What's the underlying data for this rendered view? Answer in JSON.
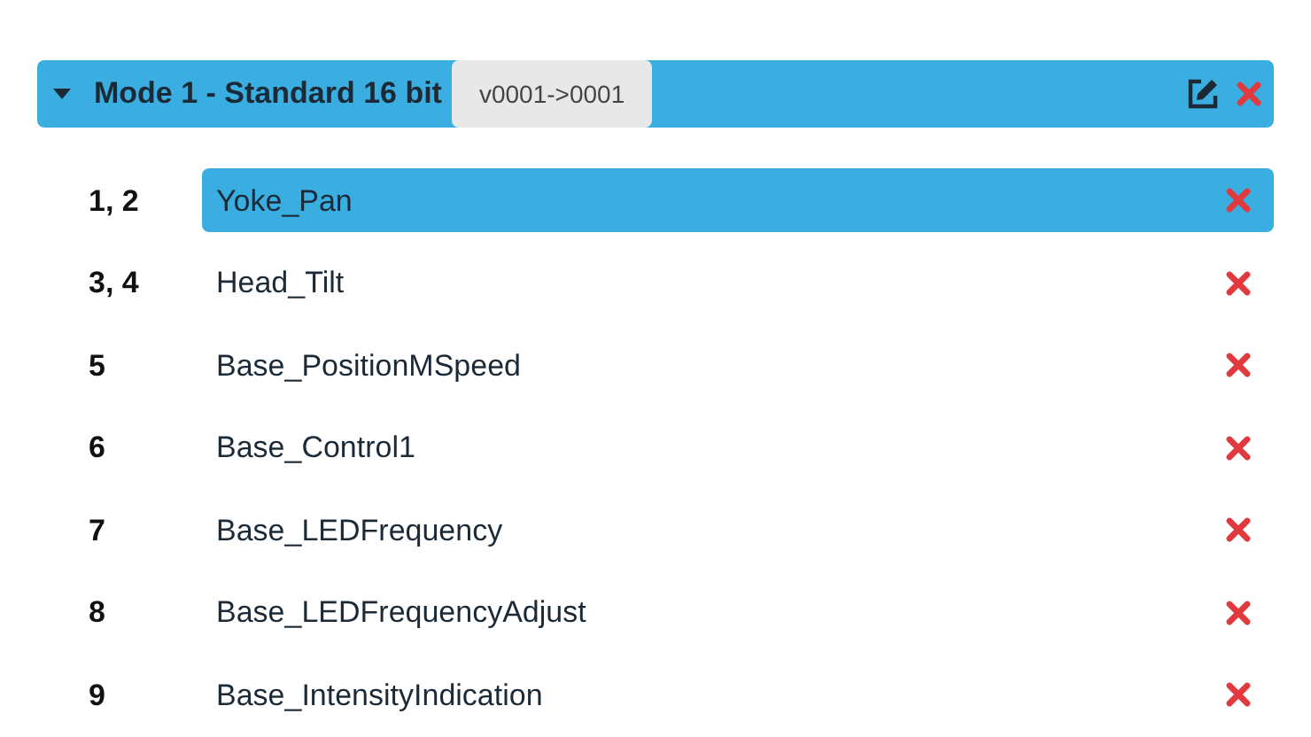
{
  "mode": {
    "title": "Mode 1 - Standard 16 bit",
    "expanded": true,
    "version": "v0001->0001"
  },
  "channels": [
    {
      "number": "1, 2",
      "name": "Yoke_Pan",
      "selected": true
    },
    {
      "number": "3, 4",
      "name": "Head_Tilt",
      "selected": false
    },
    {
      "number": "5",
      "name": "Base_PositionMSpeed",
      "selected": false
    },
    {
      "number": "6",
      "name": "Base_Control1",
      "selected": false
    },
    {
      "number": "7",
      "name": "Base_LEDFrequency",
      "selected": false
    },
    {
      "number": "8",
      "name": "Base_LEDFrequencyAdjust",
      "selected": false
    },
    {
      "number": "9",
      "name": "Base_IntensityIndication",
      "selected": false
    }
  ]
}
